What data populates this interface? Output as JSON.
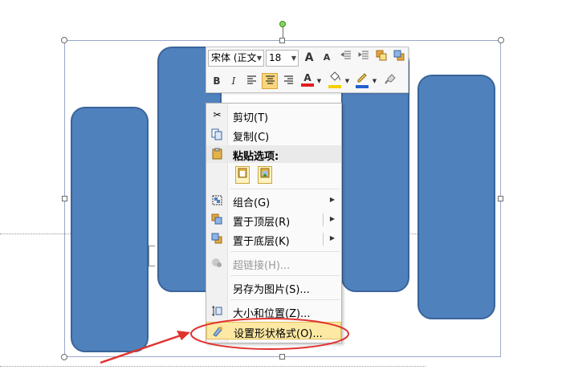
{
  "toolbar": {
    "font_name": "宋体 (正文",
    "font_size": "18",
    "bold": "B",
    "italic": "I",
    "font_color_letter": "A",
    "grow_font": "A",
    "shrink_font": "A",
    "accent_font_color": "#e02020",
    "accent_fill": "#f5d000",
    "accent_line": "#2060d0"
  },
  "menu": {
    "items": [
      {
        "label": "剪切(T)",
        "icon": "scissors-icon"
      },
      {
        "label": "复制(C)",
        "icon": "copy-icon"
      },
      {
        "label": "粘贴选项:",
        "icon": "paste-icon"
      },
      {
        "label": "组合(G)",
        "icon": "group-icon"
      },
      {
        "label": "置于顶层(R)",
        "icon": "bring-to-front-icon"
      },
      {
        "label": "置于底层(K)",
        "icon": "send-to-back-icon"
      },
      {
        "label": "超链接(H)...",
        "icon": "hyperlink-icon"
      },
      {
        "label": "另存为图片(S)...",
        "icon": ""
      },
      {
        "label": "大小和位置(Z)...",
        "icon": "size-position-icon"
      },
      {
        "label": "设置形状格式(O)...",
        "icon": "format-shape-icon"
      }
    ]
  },
  "colors": {
    "shape_fill": "#4f81bd",
    "shape_border": "#3a649a",
    "annotation": "#e0332e",
    "highlight": "#fde9a4"
  }
}
